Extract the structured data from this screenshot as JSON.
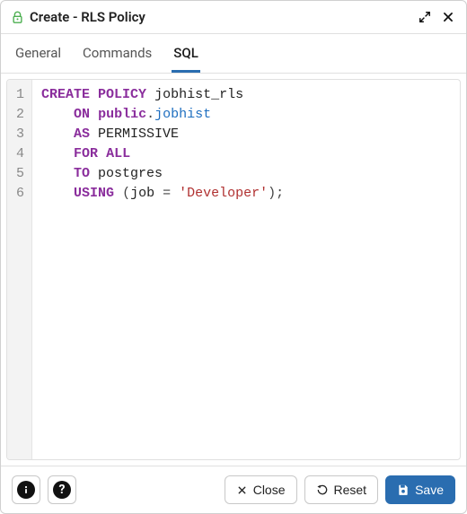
{
  "header": {
    "title": "Create - RLS Policy"
  },
  "tabs": [
    {
      "label": "General",
      "active": false
    },
    {
      "label": "Commands",
      "active": false
    },
    {
      "label": "SQL",
      "active": true
    }
  ],
  "code_lines": [
    [
      {
        "cls": "kw",
        "text": "CREATE"
      },
      {
        "cls": "plain",
        "text": " "
      },
      {
        "cls": "kw",
        "text": "POLICY"
      },
      {
        "cls": "plain",
        "text": " jobhist_rls"
      }
    ],
    [
      {
        "cls": "plain",
        "text": "    "
      },
      {
        "cls": "kw",
        "text": "ON"
      },
      {
        "cls": "plain",
        "text": " "
      },
      {
        "cls": "kw",
        "text": "public"
      },
      {
        "cls": "punct",
        "text": "."
      },
      {
        "cls": "ident",
        "text": "jobhist"
      }
    ],
    [
      {
        "cls": "plain",
        "text": "    "
      },
      {
        "cls": "kw",
        "text": "AS"
      },
      {
        "cls": "plain",
        "text": " PERMISSIVE"
      }
    ],
    [
      {
        "cls": "plain",
        "text": "    "
      },
      {
        "cls": "kw",
        "text": "FOR"
      },
      {
        "cls": "plain",
        "text": " "
      },
      {
        "cls": "kw",
        "text": "ALL"
      }
    ],
    [
      {
        "cls": "plain",
        "text": "    "
      },
      {
        "cls": "kw",
        "text": "TO"
      },
      {
        "cls": "plain",
        "text": " postgres"
      }
    ],
    [
      {
        "cls": "plain",
        "text": "    "
      },
      {
        "cls": "kw",
        "text": "USING"
      },
      {
        "cls": "plain",
        "text": " "
      },
      {
        "cls": "punct",
        "text": "("
      },
      {
        "cls": "plain",
        "text": "job "
      },
      {
        "cls": "punct",
        "text": "="
      },
      {
        "cls": "plain",
        "text": " "
      },
      {
        "cls": "str",
        "text": "'Developer'"
      },
      {
        "cls": "punct",
        "text": ")"
      },
      {
        "cls": "punct",
        "text": ";"
      }
    ]
  ],
  "footer": {
    "close": "Close",
    "reset": "Reset",
    "save": "Save"
  }
}
